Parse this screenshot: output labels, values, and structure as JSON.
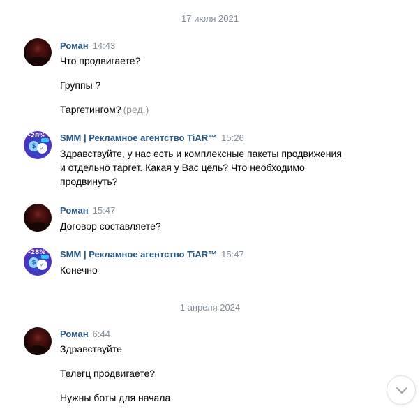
{
  "dates": [
    "17 июля 2021",
    "1 апреля 2024"
  ],
  "messages": [
    {
      "author": "Роман",
      "time": "14:43",
      "lines": [
        "Что продвигаете?",
        "Группы ?",
        "Таргетингом?"
      ],
      "edited": "(ред.)"
    },
    {
      "author": "SMM | Рекламное агентство TiAR™",
      "time": "15:26",
      "lines": [
        "Здравствуйте, у нас есть и комплексные пакеты продвижения",
        "и отдельно таргет. Какая у Вас цель? Что необходимо",
        "продвинуть?"
      ]
    },
    {
      "author": "Роман",
      "time": "15:47",
      "lines": [
        "Договор составляете?"
      ]
    },
    {
      "author": "SMM | Рекламное агентство TiAR™",
      "time": "15:47",
      "lines": [
        "Конечно"
      ]
    },
    {
      "author": "Роман",
      "time": "6:44",
      "lines": [
        "Здравствуйте",
        "Телегц продвигаете?",
        "Нужны боты для начала"
      ]
    }
  ],
  "smm_avatar_badge": "-28%",
  "icons": {
    "scroll_down": "chevron-down-icon"
  },
  "colors": {
    "author": "#2a5885",
    "meta": "#818c99",
    "text": "#000000"
  }
}
